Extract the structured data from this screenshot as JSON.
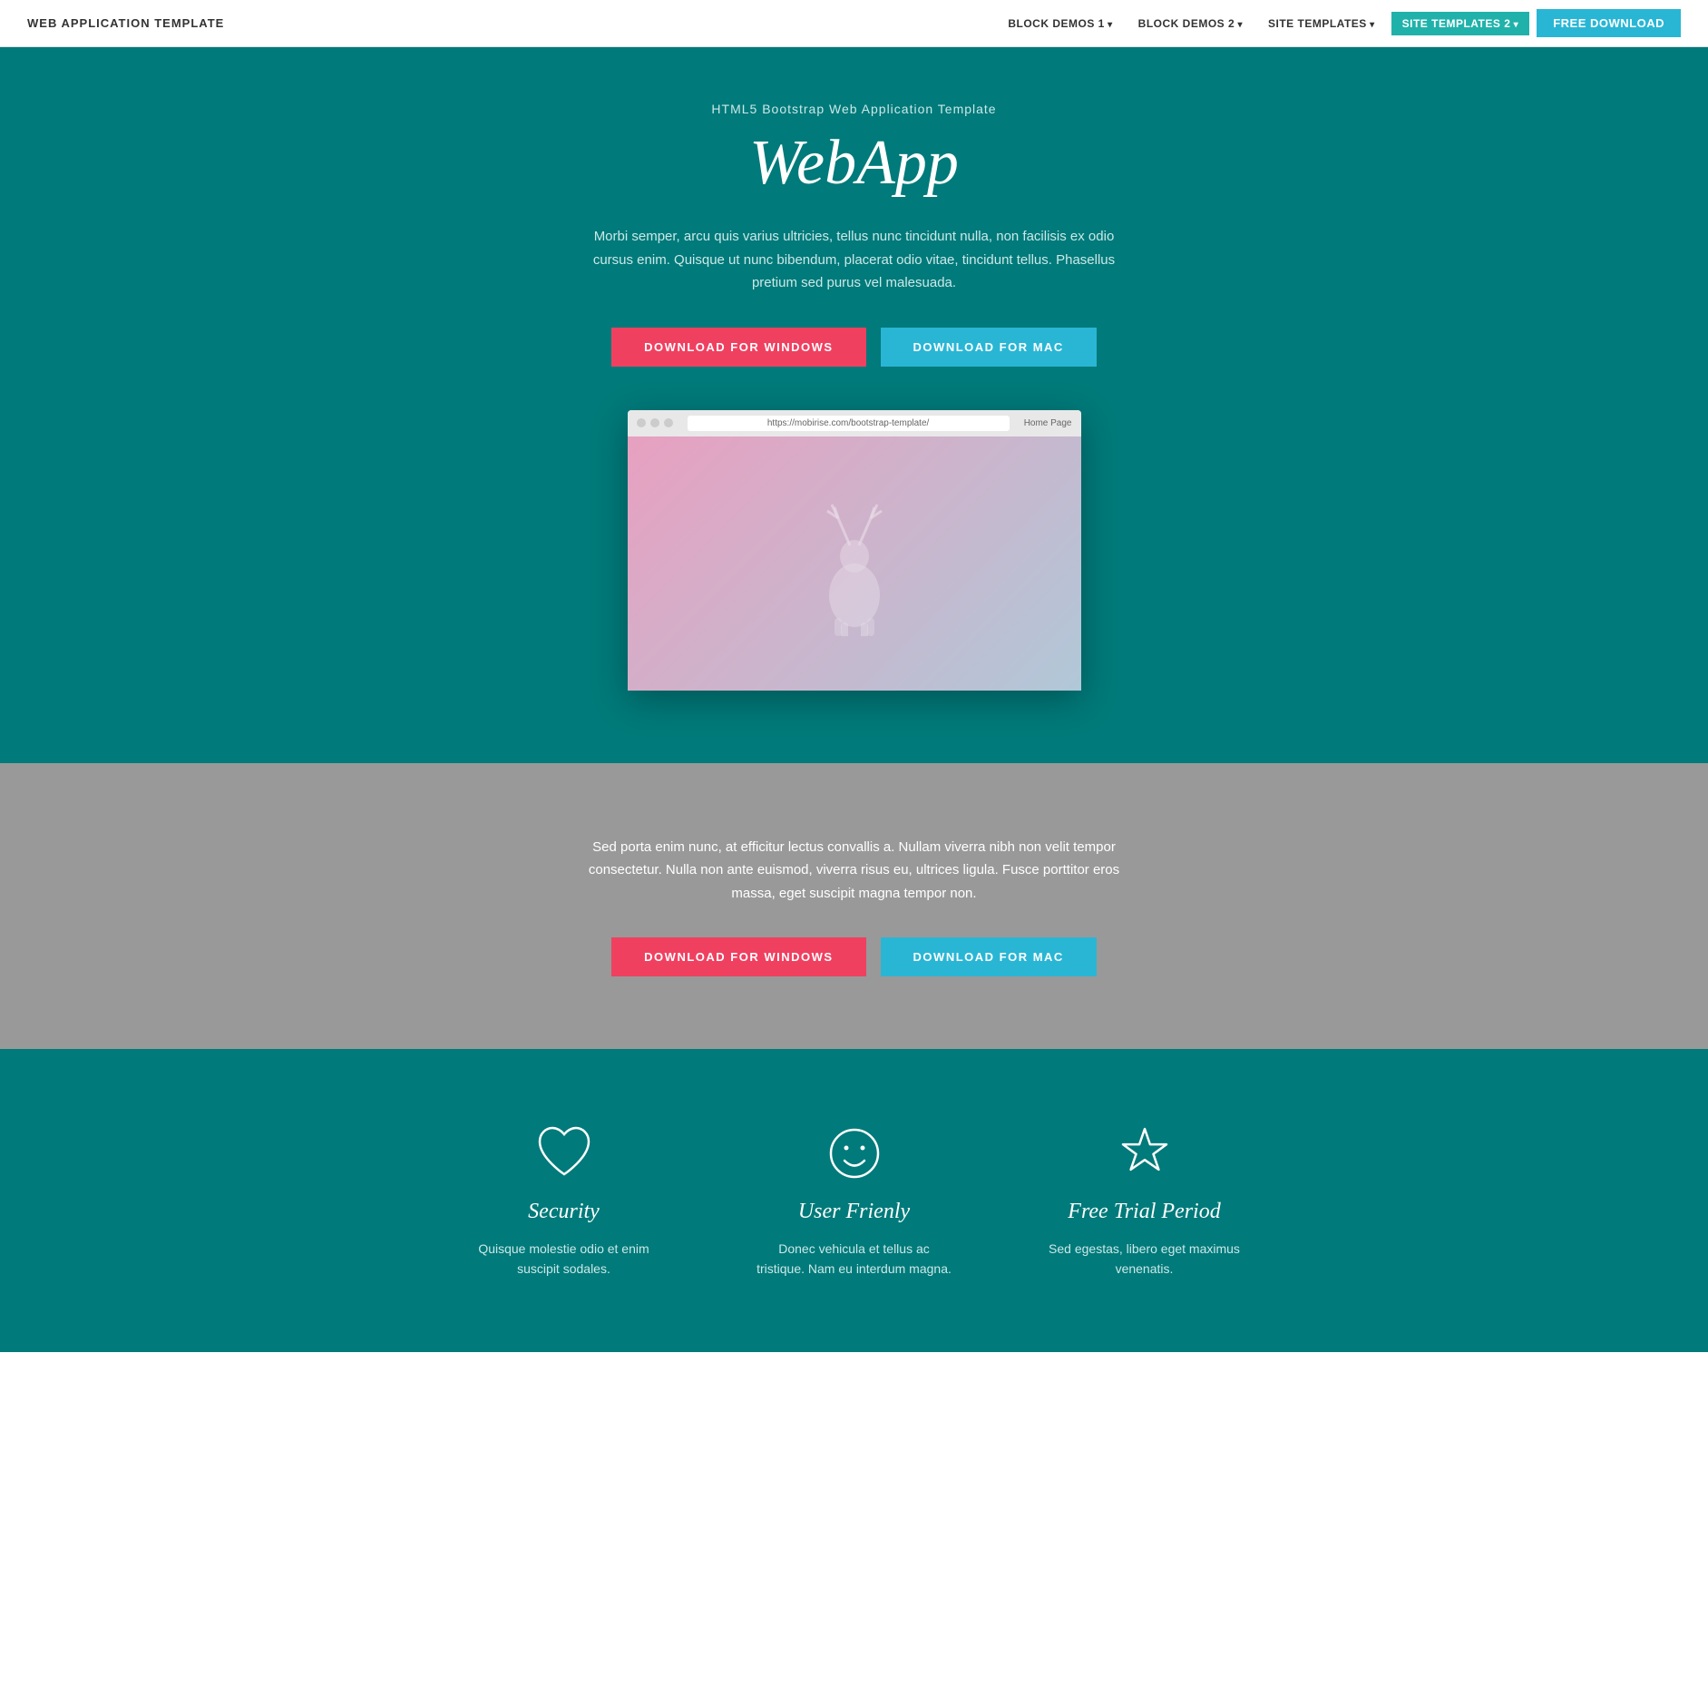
{
  "navbar": {
    "brand": "WEB APPLICATION TEMPLATE",
    "nav_items": [
      {
        "label": "BLOCK DEMOS 1",
        "active": false
      },
      {
        "label": "BLOCK DEMOS 2",
        "active": false
      },
      {
        "label": "SITE TEMPLATES",
        "active": false
      },
      {
        "label": "SITE TEMPLATES 2",
        "active": true
      }
    ],
    "free_download_label": "FREE DOWNLOAD"
  },
  "hero": {
    "subtitle": "HTML5 Bootstrap Web Application Template",
    "title": "WebApp",
    "description": "Morbi semper, arcu quis varius ultricies, tellus nunc tincidunt nulla, non facilisis ex odio cursus enim. Quisque ut nunc bibendum, placerat odio vitae, tincidunt tellus. Phasellus pretium sed purus vel malesuada.",
    "btn_windows": "DOWNLOAD FOR WINDOWS",
    "btn_mac": "DOWNLOAD FOR MAC",
    "browser_url": "https://mobirise.com/bootstrap-template/",
    "browser_home": "Home Page"
  },
  "gray_section": {
    "description": "Sed porta enim nunc, at efficitur lectus convallis a. Nullam viverra nibh non velit tempor consectetur. Nulla non ante euismod, viverra risus eu, ultrices ligula. Fusce porttitor eros massa, eget suscipit magna tempor non.",
    "btn_windows": "DOWNLOAD FOR WINDOWS",
    "btn_mac": "DOWNLOAD FOR MAC"
  },
  "features": {
    "items": [
      {
        "icon": "heart",
        "title": "Security",
        "description": "Quisque molestie odio et enim suscipit sodales."
      },
      {
        "icon": "smiley",
        "title": "User Frienly",
        "description": "Donec vehicula et tellus ac tristique. Nam eu interdum magna."
      },
      {
        "icon": "star",
        "title": "Free Trial Period",
        "description": "Sed egestas, libero eget maximus venenatis."
      }
    ]
  }
}
